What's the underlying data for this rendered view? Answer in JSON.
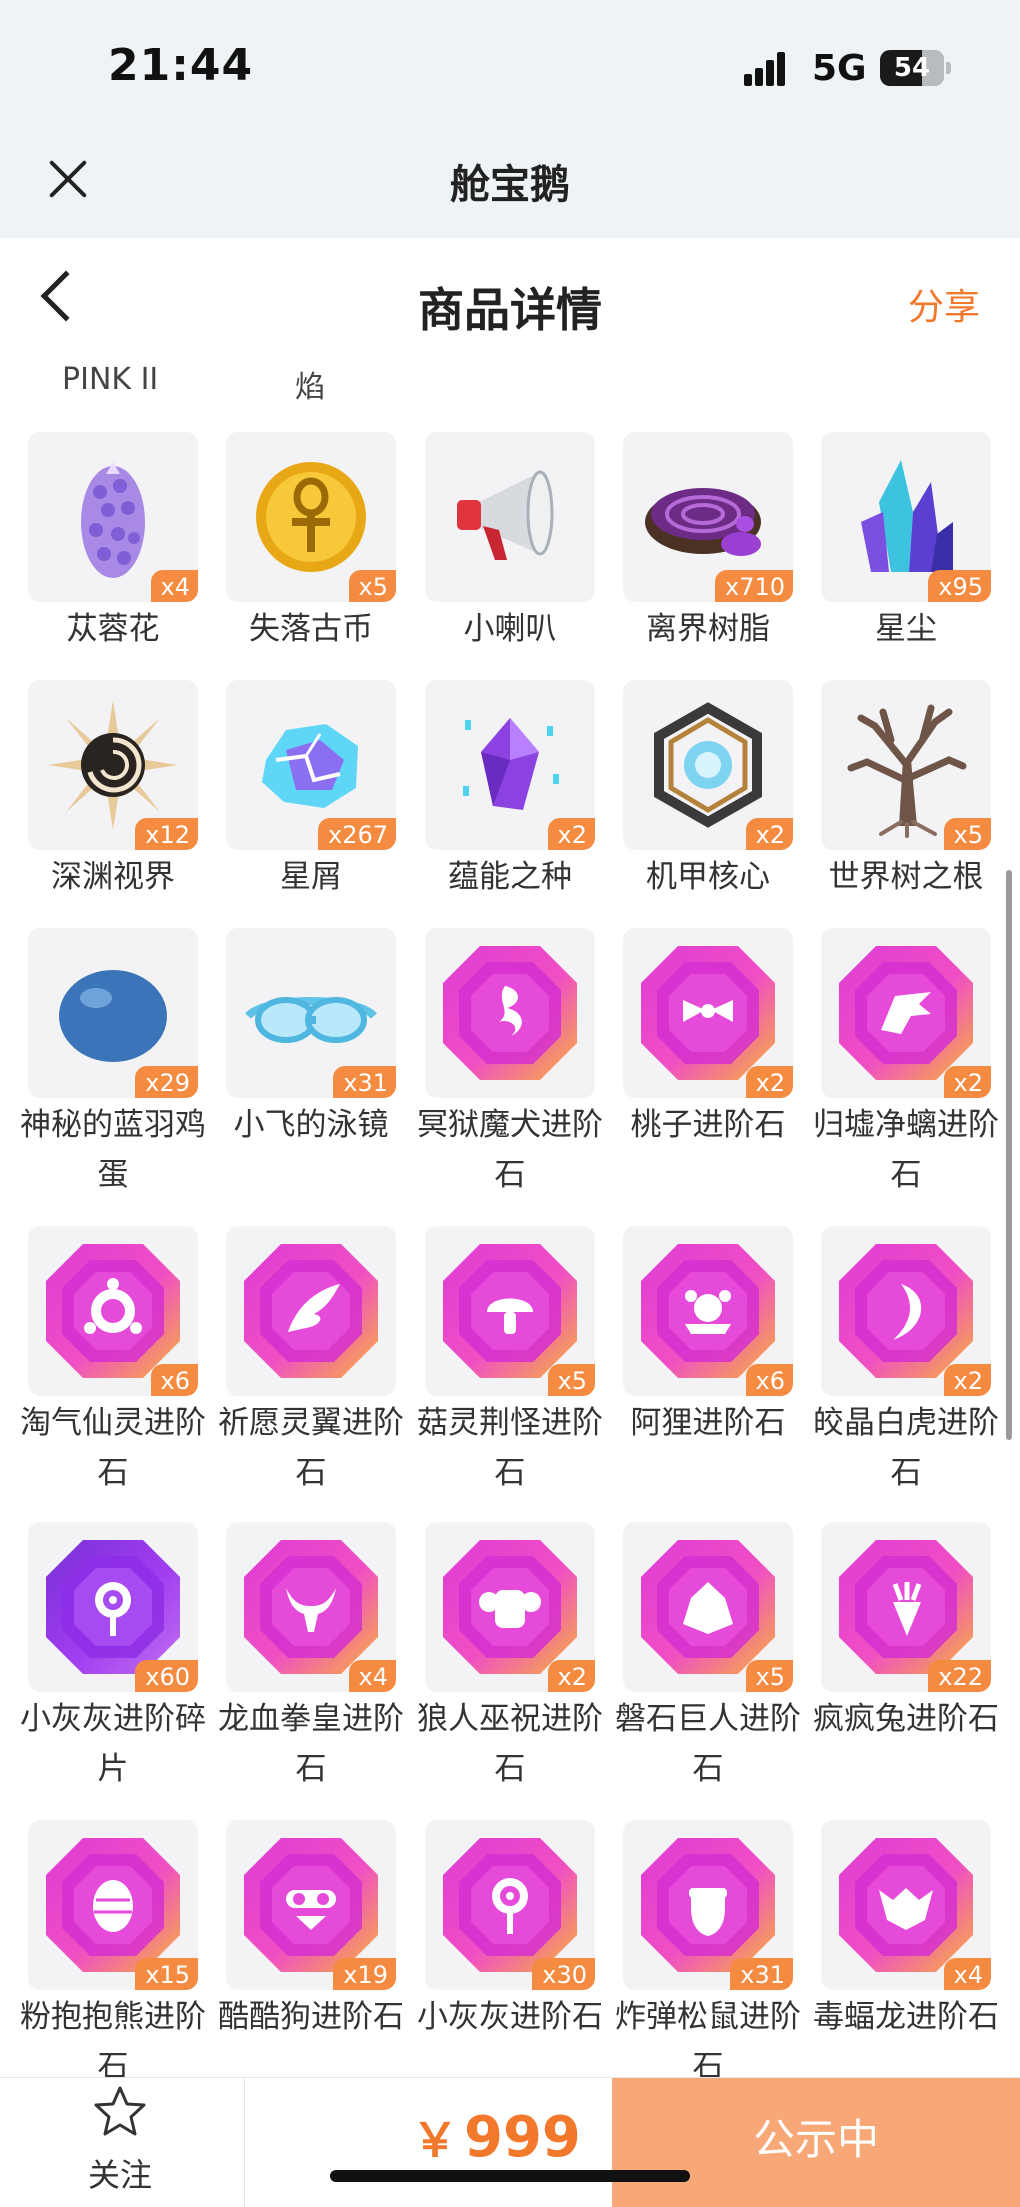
{
  "status_bar": {
    "time": "21:44",
    "network": "5G",
    "battery": "54"
  },
  "mini_program": {
    "title": "舱宝鹅"
  },
  "header": {
    "title": "商品详情",
    "share": "分享"
  },
  "owner_row": {
    "left": "PINK II",
    "right": "焰"
  },
  "items": [
    {
      "name": "苁蓉花",
      "count": "x4",
      "icon": "purple-coral-flower-icon"
    },
    {
      "name": "失落古币",
      "count": "x5",
      "icon": "gold-coin-icon"
    },
    {
      "name": "小喇叭",
      "count": "",
      "icon": "megaphone-icon"
    },
    {
      "name": "离界树脂",
      "count": "x710",
      "icon": "resin-portal-icon"
    },
    {
      "name": "星尘",
      "count": "x95",
      "icon": "crystal-cluster-icon"
    },
    {
      "name": "深渊视界",
      "count": "x12",
      "icon": "abyss-eye-icon"
    },
    {
      "name": "星屑",
      "count": "x267",
      "icon": "cracked-star-shard-icon"
    },
    {
      "name": "蕴能之种",
      "count": "x2",
      "icon": "purple-crystal-seed-icon"
    },
    {
      "name": "机甲核心",
      "count": "x2",
      "icon": "mech-core-cage-icon"
    },
    {
      "name": "世界树之根",
      "count": "x5",
      "icon": "tree-root-icon"
    },
    {
      "name": "神秘的蓝羽鸡蛋",
      "count": "x29",
      "icon": "blue-egg-icon"
    },
    {
      "name": "小飞的泳镜",
      "count": "x31",
      "icon": "goggles-icon"
    },
    {
      "name": "冥狱魔犬进阶石",
      "count": "",
      "icon": "gem-flame-icon"
    },
    {
      "name": "桃子进阶石",
      "count": "x2",
      "icon": "gem-bow-icon"
    },
    {
      "name": "归墟净螭进阶石",
      "count": "x2",
      "icon": "gem-dragon-icon"
    },
    {
      "name": "淘气仙灵进阶石",
      "count": "x6",
      "icon": "gem-fairy-icon"
    },
    {
      "name": "祈愿灵翼进阶石",
      "count": "",
      "icon": "gem-wing-icon"
    },
    {
      "name": "菇灵荆怪进阶石",
      "count": "x5",
      "icon": "gem-mushroom-icon"
    },
    {
      "name": "阿狸进阶石",
      "count": "x6",
      "icon": "gem-lion-icon"
    },
    {
      "name": "皎晶白虎进阶石",
      "count": "x2",
      "icon": "gem-fang-icon"
    },
    {
      "name": "小灰灰进阶碎片",
      "count": "x60",
      "icon": "gem-lollipop-purple-icon"
    },
    {
      "name": "龙血拳皇进阶石",
      "count": "x4",
      "icon": "gem-bull-icon"
    },
    {
      "name": "狼人巫祝进阶石",
      "count": "x2",
      "icon": "gem-ram-icon"
    },
    {
      "name": "磐石巨人进阶石",
      "count": "x5",
      "icon": "gem-rock-giant-icon"
    },
    {
      "name": "疯疯兔进阶石",
      "count": "x22",
      "icon": "gem-carrot-icon"
    },
    {
      "name": "粉抱抱熊进阶石",
      "count": "x15",
      "icon": "gem-egg-icon"
    },
    {
      "name": "酷酷狗进阶石",
      "count": "x19",
      "icon": "gem-goggle-dog-icon"
    },
    {
      "name": "小灰灰进阶石",
      "count": "x30",
      "icon": "gem-lollipop-icon"
    },
    {
      "name": "炸弹松鼠进阶石",
      "count": "x31",
      "icon": "gem-acorn-icon"
    },
    {
      "name": "毒蝠龙进阶石",
      "count": "x4",
      "icon": "gem-bat-icon"
    }
  ],
  "bottom_bar": {
    "follow": "关注",
    "currency": "￥",
    "price": "999",
    "status_button": "公示中"
  },
  "colors": {
    "accent": "#f2782b",
    "badge": "#f58a41",
    "button": "#f8a877"
  }
}
